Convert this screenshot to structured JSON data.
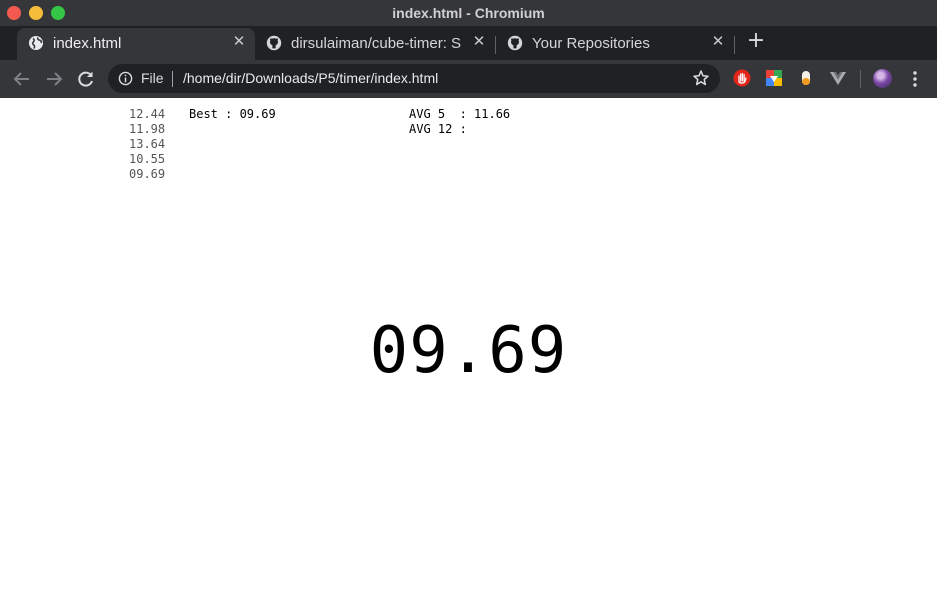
{
  "window": {
    "title": "index.html - Chromium"
  },
  "tabs": [
    {
      "label": "index.html",
      "icon": "globe-icon",
      "active": true
    },
    {
      "label": "dirsulaiman/cube-timer: S",
      "icon": "github-icon",
      "active": false
    },
    {
      "label": "Your Repositories",
      "icon": "github-icon",
      "active": false
    }
  ],
  "toolbar": {
    "scheme_label": "File",
    "url": "/home/dir/Downloads/P5/timer/index.html",
    "extensions": [
      "hand-stop-extension-icon",
      "drive-extension-icon",
      "capsule-extension-icon",
      "vue-extension-icon"
    ]
  },
  "page": {
    "times": [
      "12.44",
      "11.98",
      "13.64",
      "10.55",
      "09.69"
    ],
    "best_label": "Best : ",
    "best_value": "09.69",
    "avg5_label": "AVG 5  : ",
    "avg5_value": "11.66",
    "avg12_label": "AVG 12 : ",
    "avg12_value": "",
    "timer_display": "09.69"
  },
  "colors": {
    "titlebar": "#35363a",
    "tabstrip": "#202124",
    "toolbar": "#35363a",
    "omnibox": "#202124",
    "close": "#f35a4f",
    "minimize": "#f6bd3b",
    "maximize": "#35c648"
  }
}
